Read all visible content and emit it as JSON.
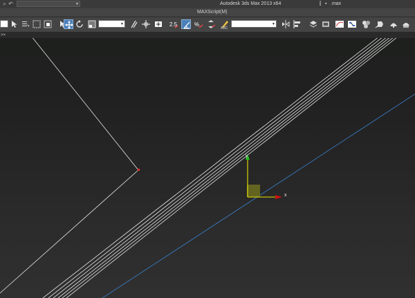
{
  "titlebar": {
    "quick_access_icons": [
      "app-menu-icon",
      "undo-icon"
    ],
    "workspace_label": "",
    "app_title": "Autodesk 3ds Max  2013 x64",
    "file_title": ".max"
  },
  "menu": {
    "items": [
      "",
      "",
      "",
      "",
      "",
      "",
      "",
      "",
      "",
      "MAXScript(M)",
      ""
    ]
  },
  "toolbar": {
    "selection_filter": "",
    "reference_coord": "",
    "named_selection": ""
  },
  "command_line": {
    "text": ">>"
  },
  "viewport": {
    "axis_x_label": "x",
    "axis_y_label": "y",
    "colors": {
      "wire": "#e6e6e6",
      "vertex": "#ff3030",
      "blue_line": "#3a78c0",
      "gizmo_x": "#cc1010",
      "gizmo_y": "#20c020",
      "gizmo_plane": "#e6e600"
    }
  }
}
